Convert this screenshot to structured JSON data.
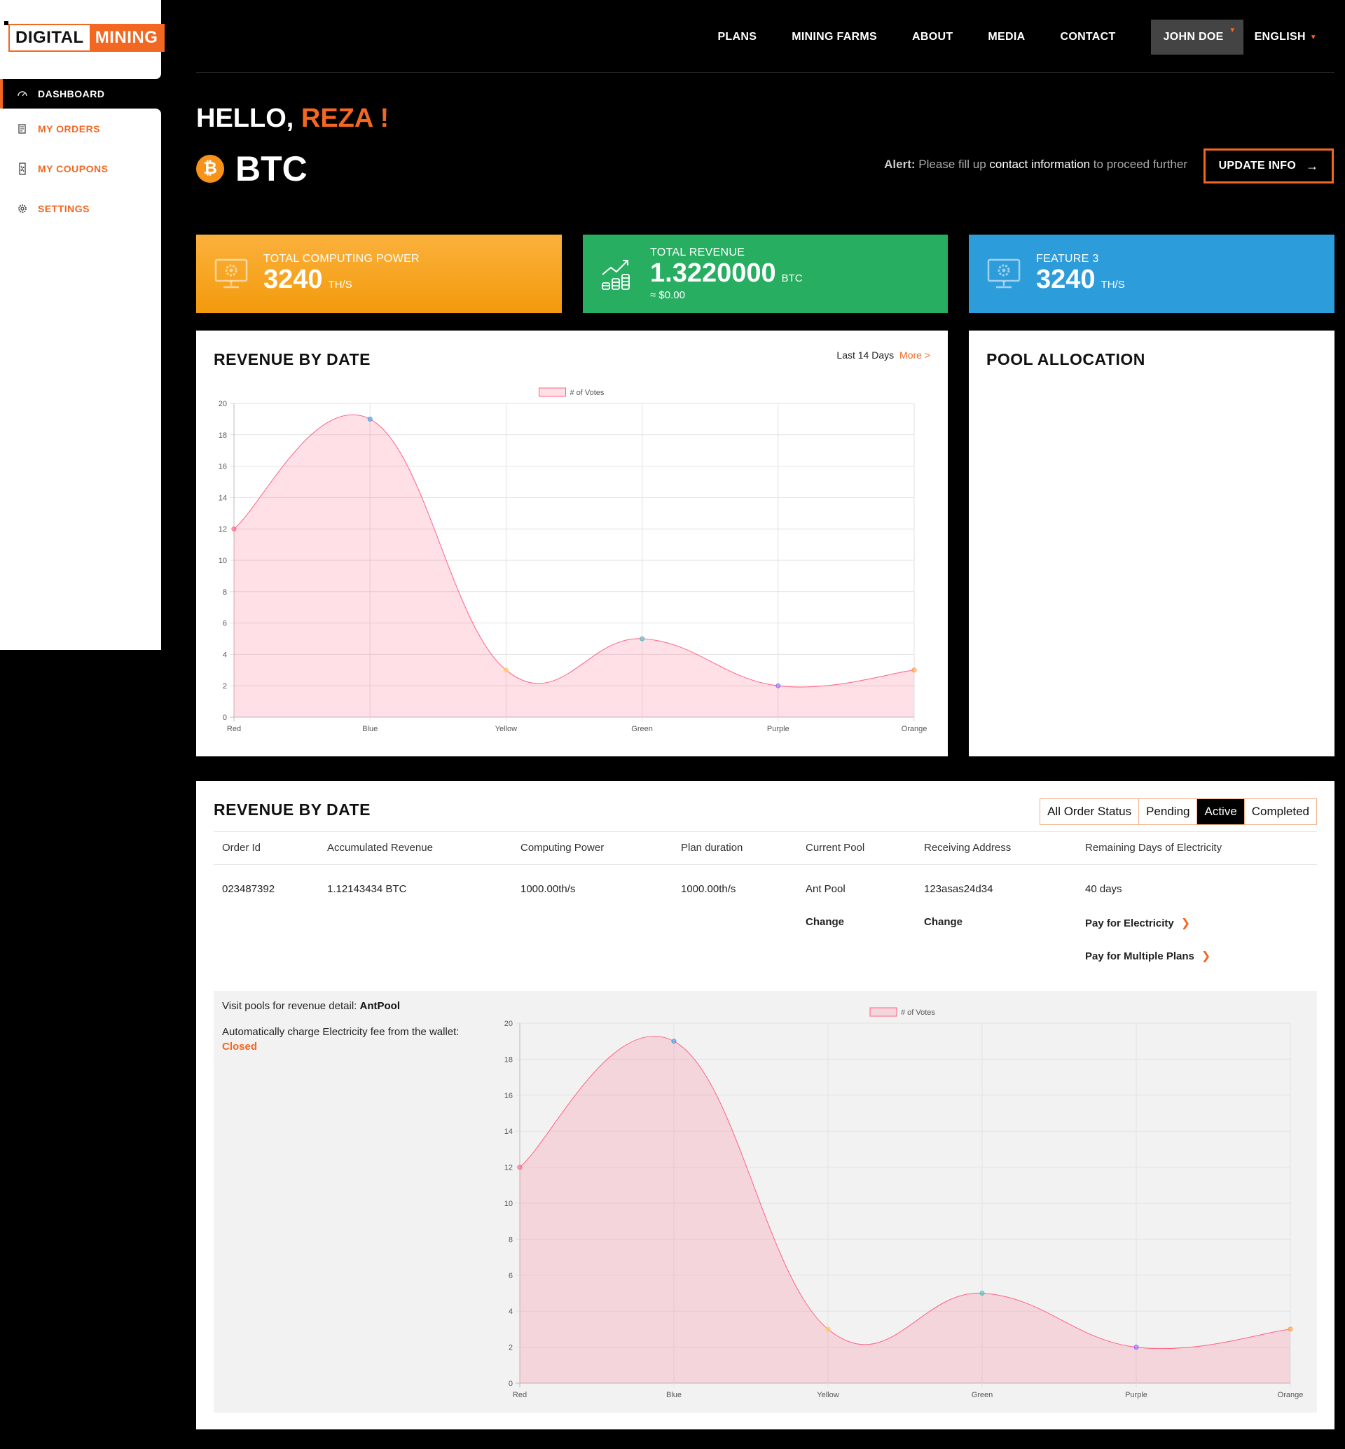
{
  "brand": {
    "part1": "DIGITAL",
    "part2": "MINING",
    "accent": "#f26722"
  },
  "sidebar": {
    "active": {
      "label": "DASHBOARD",
      "icon": "dashboard-icon"
    },
    "items": [
      {
        "label": "MY ORDERS",
        "icon": "orders-icon"
      },
      {
        "label": "MY COUPONS",
        "icon": "coupon-icon"
      },
      {
        "label": "SETTINGS",
        "icon": "gear-icon"
      }
    ]
  },
  "topnav": {
    "items": [
      "PLANS",
      "MINING FARMS",
      "ABOUT",
      "MEDIA",
      "CONTACT"
    ],
    "user": "JOHN DOE",
    "language": "ENGLISH"
  },
  "greeting": {
    "prefix": "HELLO,",
    "name": "REZA !"
  },
  "coin": {
    "symbol": "₿",
    "name": "BTC",
    "color": "#f7931a"
  },
  "alert": {
    "label": "Alert:",
    "text1": "Please fill up",
    "link": "contact information",
    "text2": "to proceed further"
  },
  "update_button": "UPDATE INFO",
  "cards": [
    {
      "label": "TOTAL COMPUTING POWER",
      "value": "3240",
      "unit": "TH/S",
      "sub": "",
      "color": "#f7a21c",
      "icon": "monitor-gear-icon"
    },
    {
      "label": "TOTAL REVENUE",
      "value": "1.3220000",
      "unit": "BTC",
      "sub": "≈ $0.00",
      "color": "#27ae60",
      "icon": "revenue-growth-icon"
    },
    {
      "label": "FEATURE 3",
      "value": "3240",
      "unit": "TH/S",
      "sub": "",
      "color": "#2d9cdb",
      "icon": "monitor-gear-icon"
    }
  ],
  "revenue_panel": {
    "title": "REVENUE BY DATE",
    "range": "Last 14 Days",
    "more": "More >"
  },
  "pool_panel": {
    "title": "POOL ALLOCATION"
  },
  "orders_panel": {
    "title": "REVENUE BY DATE",
    "tabs": [
      "All Order Status",
      "Pending",
      "Active",
      "Completed"
    ],
    "active_tab": "Active",
    "columns": [
      "Order Id",
      "Accumulated Revenue",
      "Computing Power",
      "Plan duration",
      "Current Pool",
      "Receiving Address",
      "Remaining Days of Electricity"
    ],
    "row": {
      "order_id": "023487392",
      "revenue": "1.12143434 BTC",
      "power": "1000.00th/s",
      "duration": "1000.00th/s",
      "pool": "Ant Pool",
      "address": "123asas24d34",
      "days": "40 days",
      "change_pool": "Change",
      "change_address": "Change",
      "pay_electricity": "Pay for Electricity",
      "pay_multiple": "Pay for Multiple Plans"
    },
    "detail": {
      "visit_label": "Visit pools for revenue detail:",
      "visit_pool": "AntPool",
      "charge_label": "Automatically charge Electricity fee from the wallet:",
      "charge_status": "Closed"
    }
  },
  "chart_data": [
    {
      "type": "area",
      "categories": [
        "Red",
        "Blue",
        "Yellow",
        "Green",
        "Purple",
        "Orange"
      ],
      "series": [
        {
          "name": "# of Votes",
          "values": [
            12,
            19,
            3,
            5,
            2,
            3
          ],
          "color": "#ff6384"
        }
      ],
      "point_colors": [
        "#ff6384",
        "#36a2eb",
        "#ffce56",
        "#4bc0c0",
        "#9966ff",
        "#ff9f40"
      ],
      "ylim": [
        0,
        20
      ],
      "yticks": [
        0,
        2,
        4,
        6,
        8,
        10,
        12,
        14,
        16,
        18,
        20
      ],
      "grid": true,
      "legend": "top"
    },
    {
      "type": "area",
      "categories": [
        "Red",
        "Blue",
        "Yellow",
        "Green",
        "Purple",
        "Orange"
      ],
      "series": [
        {
          "name": "# of Votes",
          "values": [
            12,
            19,
            3,
            5,
            2,
            3
          ],
          "color": "#ff6384"
        }
      ],
      "point_colors": [
        "#ff6384",
        "#36a2eb",
        "#ffce56",
        "#4bc0c0",
        "#9966ff",
        "#ff9f40"
      ],
      "ylim": [
        0,
        20
      ],
      "yticks": [
        0,
        2,
        4,
        6,
        8,
        10,
        12,
        14,
        16,
        18,
        20
      ],
      "grid": true,
      "legend": "top"
    }
  ]
}
